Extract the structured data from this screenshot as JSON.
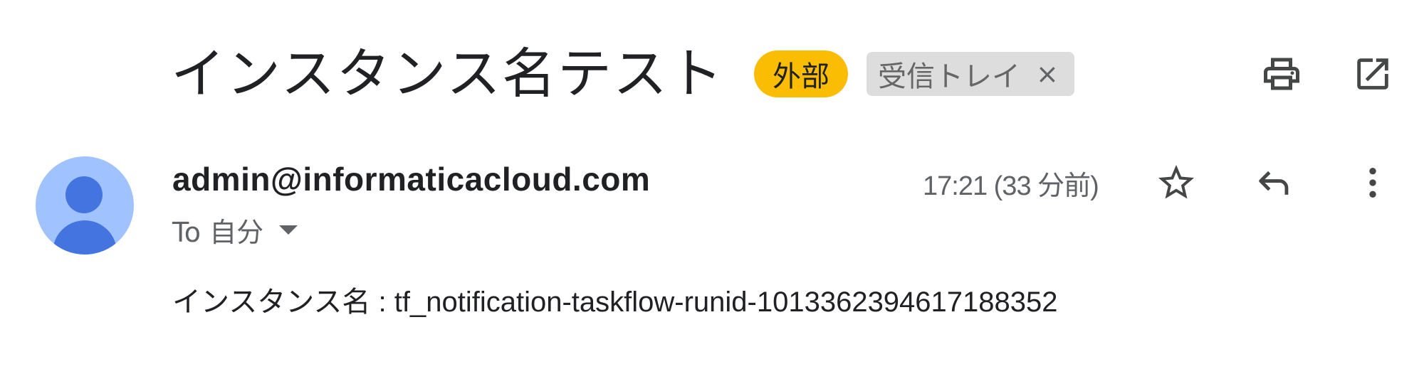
{
  "email": {
    "subject": "インスタンス名テスト",
    "labels": [
      {
        "name": "外部",
        "color": "#fbbc04"
      },
      {
        "name": "受信トレイ",
        "color": "#dddddd",
        "removable": true
      }
    ],
    "remove_label_glyph": "×",
    "toolbar": {
      "print_icon": "print-icon",
      "open_new_window_icon": "open-in-new-window-icon"
    },
    "sender": "admin@informaticacloud.com",
    "recipient": "To 自分",
    "timestamp": "17:21 (33 分前)",
    "actions": {
      "star_icon": "star-icon",
      "reply_icon": "reply-icon",
      "more_icon": "more-vert-icon"
    },
    "body": "インスタンス名 : tf_notification-taskflow-runid-1013362394617188352",
    "colors": {
      "avatar_bg": "#a0c3ff",
      "avatar_fg": "#4374e0",
      "text_primary": "#202124",
      "text_secondary": "#5f6368"
    }
  }
}
